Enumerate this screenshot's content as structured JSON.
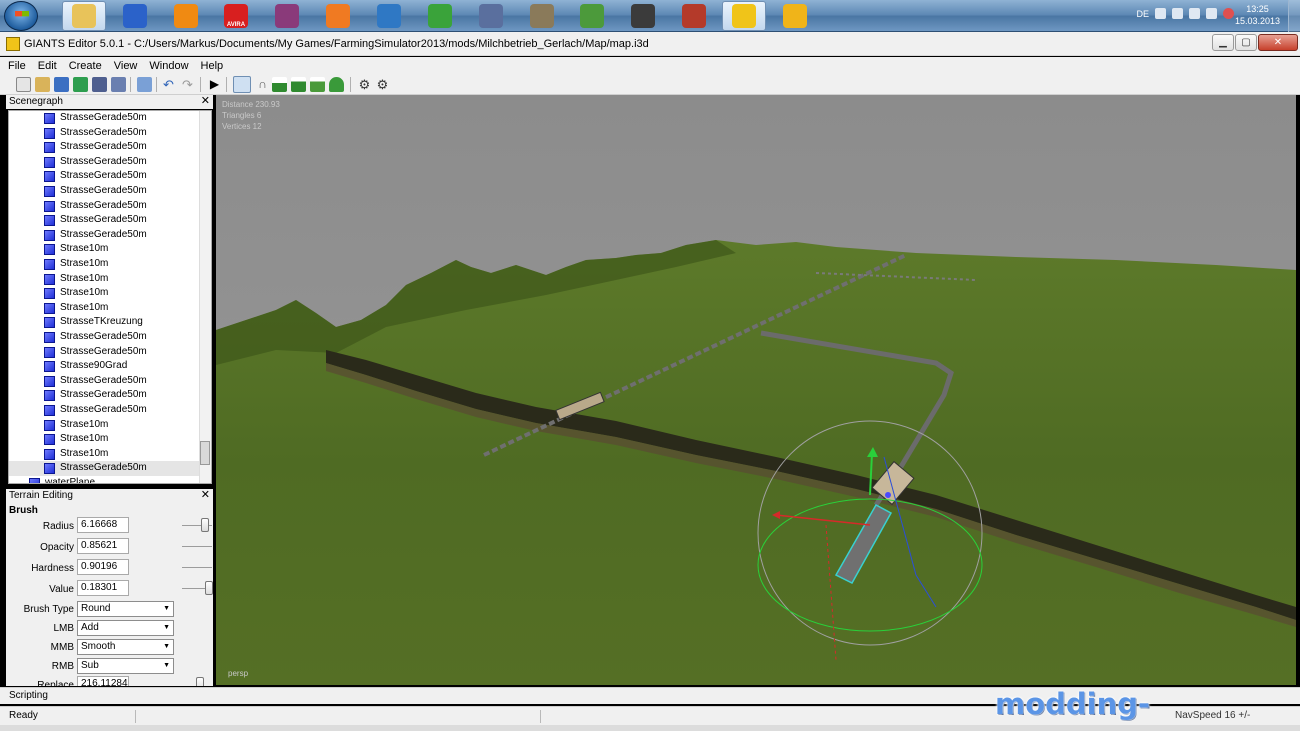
{
  "taskbar": {
    "apps": [
      {
        "name": "explorer-icon",
        "color": "#e8c35a",
        "active": true
      },
      {
        "name": "thunderbird-icon",
        "color": "#2b62c9"
      },
      {
        "name": "vlc-icon",
        "color": "#f08a12"
      },
      {
        "name": "avira-icon",
        "color": "#d81f1f",
        "label": "AVIRA"
      },
      {
        "name": "winrar-icon",
        "color": "#8a3a7a"
      },
      {
        "name": "media-icon",
        "color": "#f07a22"
      },
      {
        "name": "thunderbird-mail-icon",
        "color": "#2f78c4"
      },
      {
        "name": "utorrent-icon",
        "color": "#3aa33a"
      },
      {
        "name": "editor-icon",
        "color": "#5a6f9e"
      },
      {
        "name": "gimp-icon",
        "color": "#8a7a5a"
      },
      {
        "name": "chart-icon",
        "color": "#4c9a3b"
      },
      {
        "name": "tractor-icon",
        "color": "#3b3b3b"
      },
      {
        "name": "farming-simulator-icon",
        "color": "#b43a2a"
      },
      {
        "name": "giants-editor-icon",
        "color": "#f0c419",
        "active": true
      },
      {
        "name": "tools-icon",
        "color": "#f0b419"
      }
    ],
    "language": "DE",
    "time": "13:25",
    "date": "15.03.2013"
  },
  "window": {
    "title": "GIANTS Editor 5.0.1 - C:/Users/Markus/Documents/My Games/FarmingSimulator2013/mods/Milchbetrieb_Gerlach/Map/map.i3d"
  },
  "menu": [
    "File",
    "Edit",
    "Create",
    "View",
    "Window",
    "Help"
  ],
  "scenegraph": {
    "title": "Scenegraph",
    "items": [
      "StrasseGerade50m",
      "StrasseGerade50m",
      "StrasseGerade50m",
      "StrasseGerade50m",
      "StrasseGerade50m",
      "StrasseGerade50m",
      "StrasseGerade50m",
      "StrasseGerade50m",
      "StrasseGerade50m",
      "Strase10m",
      "Strase10m",
      "Strase10m",
      "Strase10m",
      "Strase10m",
      "StrasseTKreuzung",
      "StrasseGerade50m",
      "StrasseGerade50m",
      "Strasse90Grad",
      "StrasseGerade50m",
      "StrasseGerade50m",
      "StrasseGerade50m",
      "Strase10m",
      "Strase10m",
      "Strase10m",
      "StrasseGerade50m"
    ],
    "partial_item": "waterPlane"
  },
  "terrain_editing": {
    "title": "Terrain Editing",
    "section": "Brush",
    "fields": [
      {
        "label": "Radius",
        "value": "6.16668",
        "slider": 0.8
      },
      {
        "label": "Opacity",
        "value": "0.85621",
        "slider": null
      },
      {
        "label": "Hardness",
        "value": "0.90196",
        "slider": null
      },
      {
        "label": "Value",
        "value": "0.18301",
        "slider": 0.95
      }
    ],
    "selects": [
      {
        "label": "Brush Type",
        "value": "Round"
      },
      {
        "label": "LMB",
        "value": "Add"
      },
      {
        "label": "MMB",
        "value": "Smooth"
      },
      {
        "label": "RMB",
        "value": "Sub"
      }
    ],
    "partial_field": {
      "label": "Replace",
      "value": "216.11284"
    }
  },
  "viewport": {
    "info": [
      "Distance 230.93",
      "Triangles 6",
      "Vertices 12"
    ],
    "camera": "persp"
  },
  "scripting_label": "Scripting",
  "status": {
    "text": "Ready",
    "navspeed": "NavSpeed 16 +/-"
  },
  "watermark": "modding-welt.com"
}
